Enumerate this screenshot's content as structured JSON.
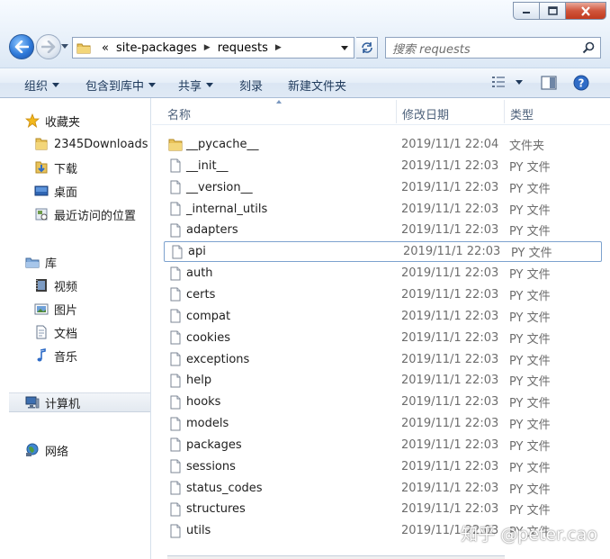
{
  "window": {
    "caption_buttons": [
      "minimize",
      "maximize",
      "close"
    ]
  },
  "address_bar": {
    "prefix": "«",
    "segments": [
      "site-packages",
      "requests"
    ],
    "separator_icon": "chevron-right-icon"
  },
  "search": {
    "placeholder": "搜索 requests"
  },
  "commands": {
    "organize": "组织",
    "include_in_library": "包含到库中",
    "share": "共享",
    "burn": "刻录",
    "new_folder": "新建文件夹"
  },
  "navigation": {
    "favorites": {
      "label": "收藏夹",
      "items": [
        "2345Downloads",
        "下载",
        "桌面",
        "最近访问的位置"
      ]
    },
    "libraries": {
      "label": "库",
      "items": [
        "视频",
        "图片",
        "文档",
        "音乐"
      ]
    },
    "computer": "计算机",
    "network": "网络"
  },
  "columns": {
    "name": "名称",
    "date_modified": "修改日期",
    "type": "类型"
  },
  "files": [
    {
      "name": "__pycache__",
      "date": "2019/11/1 22:04",
      "type": "文件夹",
      "kind": "folder"
    },
    {
      "name": "__init__",
      "date": "2019/11/1 22:03",
      "type": "PY 文件",
      "kind": "file"
    },
    {
      "name": "__version__",
      "date": "2019/11/1 22:03",
      "type": "PY 文件",
      "kind": "file"
    },
    {
      "name": "_internal_utils",
      "date": "2019/11/1 22:03",
      "type": "PY 文件",
      "kind": "file"
    },
    {
      "name": "adapters",
      "date": "2019/11/1 22:03",
      "type": "PY 文件",
      "kind": "file"
    },
    {
      "name": "api",
      "date": "2019/11/1 22:03",
      "type": "PY 文件",
      "kind": "file"
    },
    {
      "name": "auth",
      "date": "2019/11/1 22:03",
      "type": "PY 文件",
      "kind": "file"
    },
    {
      "name": "certs",
      "date": "2019/11/1 22:03",
      "type": "PY 文件",
      "kind": "file"
    },
    {
      "name": "compat",
      "date": "2019/11/1 22:03",
      "type": "PY 文件",
      "kind": "file"
    },
    {
      "name": "cookies",
      "date": "2019/11/1 22:03",
      "type": "PY 文件",
      "kind": "file"
    },
    {
      "name": "exceptions",
      "date": "2019/11/1 22:03",
      "type": "PY 文件",
      "kind": "file"
    },
    {
      "name": "help",
      "date": "2019/11/1 22:03",
      "type": "PY 文件",
      "kind": "file"
    },
    {
      "name": "hooks",
      "date": "2019/11/1 22:03",
      "type": "PY 文件",
      "kind": "file"
    },
    {
      "name": "models",
      "date": "2019/11/1 22:03",
      "type": "PY 文件",
      "kind": "file"
    },
    {
      "name": "packages",
      "date": "2019/11/1 22:03",
      "type": "PY 文件",
      "kind": "file"
    },
    {
      "name": "sessions",
      "date": "2019/11/1 22:03",
      "type": "PY 文件",
      "kind": "file"
    },
    {
      "name": "status_codes",
      "date": "2019/11/1 22:03",
      "type": "PY 文件",
      "kind": "file"
    },
    {
      "name": "structures",
      "date": "2019/11/1 22:03",
      "type": "PY 文件",
      "kind": "file"
    },
    {
      "name": "utils",
      "date": "2019/11/1 22:03",
      "type": "PY 文件",
      "kind": "file"
    }
  ],
  "focused_file": "api",
  "watermark": "知乎 @peter.cao"
}
